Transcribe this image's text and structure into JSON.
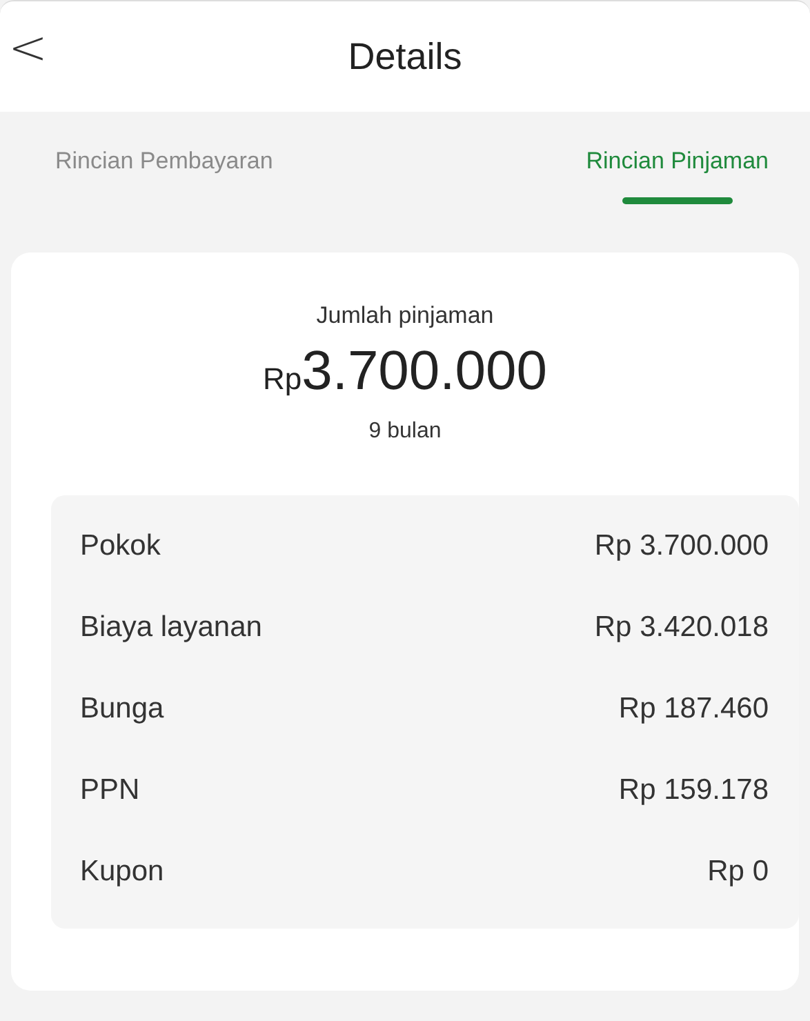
{
  "header": {
    "back": "<",
    "title": "Details"
  },
  "tabs": [
    {
      "label": "Rincian Pembayaran",
      "selected": false
    },
    {
      "label": "Rincian Pinjaman",
      "selected": true
    }
  ],
  "summary": {
    "label": "Jumlah pinjaman",
    "currency": "Rp",
    "amount": "3.700.000",
    "tenor": "9 bulan"
  },
  "breakdown": [
    {
      "label": "Pokok",
      "value": "Rp 3.700.000"
    },
    {
      "label": "Biaya layanan",
      "value": "Rp 3.420.018"
    },
    {
      "label": "Bunga",
      "value": "Rp 187.460"
    },
    {
      "label": "PPN",
      "value": "Rp 159.178"
    },
    {
      "label": "Kupon",
      "value": "Rp 0"
    }
  ]
}
